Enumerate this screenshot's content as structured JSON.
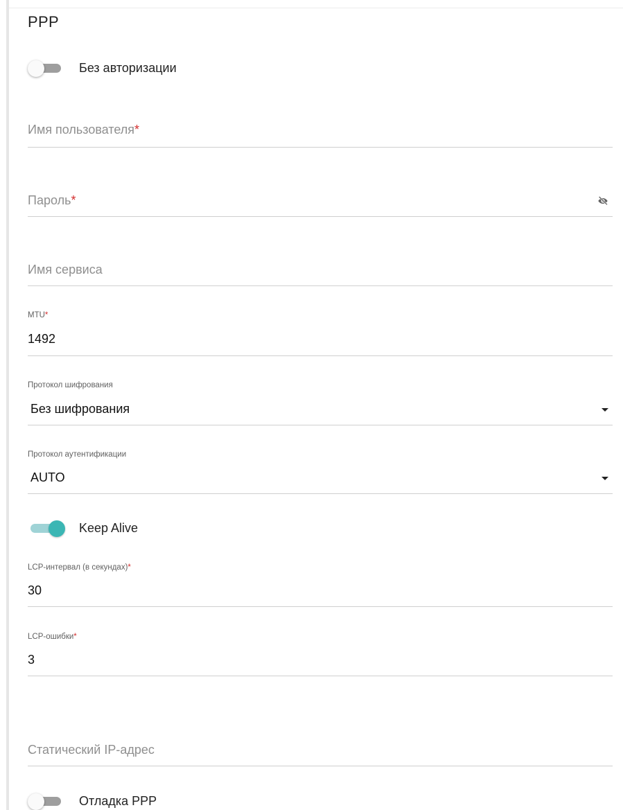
{
  "section": {
    "title": "PPP"
  },
  "no_auth_toggle": {
    "label": "Без авторизации",
    "checked": false
  },
  "username": {
    "placeholder": "Имя пользователя",
    "required_mark": "*",
    "value": ""
  },
  "password": {
    "placeholder": "Пароль",
    "required_mark": "*",
    "value": "",
    "icon": "eye-off-icon"
  },
  "service_name": {
    "placeholder": "Имя сервиса",
    "value": ""
  },
  "mtu": {
    "label": "MTU",
    "required_mark": "*",
    "value": "1492"
  },
  "encryption": {
    "label": "Протокол шифрования",
    "value": "Без шифрования",
    "icon": "caret-down-icon"
  },
  "auth_protocol": {
    "label": "Протокол аутентификации",
    "value": "AUTO",
    "icon": "caret-down-icon"
  },
  "keep_alive_toggle": {
    "label": "Keep Alive",
    "checked": true
  },
  "lcp_interval": {
    "label": "LCP-интервал (в секундах)",
    "required_mark": "*",
    "value": "30"
  },
  "lcp_failures": {
    "label": "LCP-ошибки",
    "required_mark": "*",
    "value": "3"
  },
  "static_ip": {
    "placeholder": "Статический IP-адрес",
    "value": ""
  },
  "ppp_debug_toggle": {
    "label": "Отладка PPP",
    "checked": false
  },
  "colors": {
    "accent": "#3bb6b4",
    "accent_track": "#9fd3d6",
    "required": "#d32f2f",
    "toggle_off_track": "#9e9e9e"
  }
}
